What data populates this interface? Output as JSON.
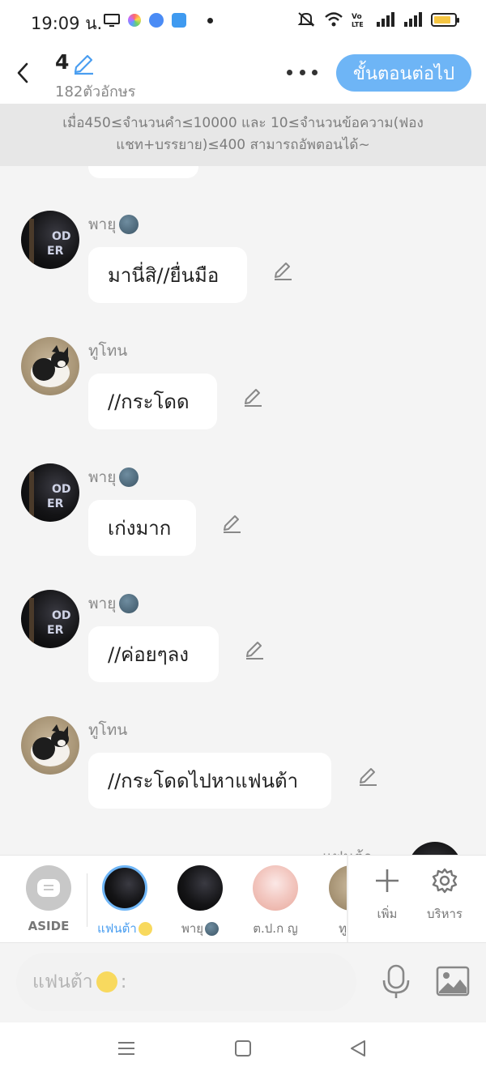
{
  "status_bar": {
    "time": "19:09 น."
  },
  "header": {
    "episode_number": "4",
    "char_count": "182ตัวอักษร",
    "next_button": "ขั้นตอนต่อไป"
  },
  "notice": "เมื่อ450≤จำนวนคำ≤10000 และ 10≤จำนวนข้อความ(ฟองแชท+บรรยาย)≤400 สามารถอัพตอนได้~",
  "messages": [
    {
      "sender": "พายุ",
      "text": "มานี่สิ//ยื่นมือ",
      "avatar": "dark"
    },
    {
      "sender": "ทูโทน",
      "text": "//กระโดด",
      "avatar": "cat"
    },
    {
      "sender": "พายุ",
      "text": "เก่งมาก",
      "avatar": "dark"
    },
    {
      "sender": "พายุ",
      "text": "//ค่อยๆลง",
      "avatar": "dark"
    },
    {
      "sender": "ทูโทน",
      "text": "//กระโดดไปหาแฟนต้า",
      "avatar": "cat"
    }
  ],
  "partial_message": {
    "sender": "แฟนต้า"
  },
  "characters": [
    {
      "label": "ASIDE"
    },
    {
      "label": "แฟนต้า",
      "selected": true
    },
    {
      "label": "พายุ"
    },
    {
      "label": "ต.ป.ก ญ"
    },
    {
      "label": "ทู"
    }
  ],
  "tools": {
    "add_label": "เพิ่ม",
    "manage_label": "บริหาร"
  },
  "input": {
    "placeholder": "แฟนต้า",
    "placeholder_suffix": ":"
  },
  "colors": {
    "accent": "#6eb5f6",
    "background": "#f4f4f4"
  }
}
